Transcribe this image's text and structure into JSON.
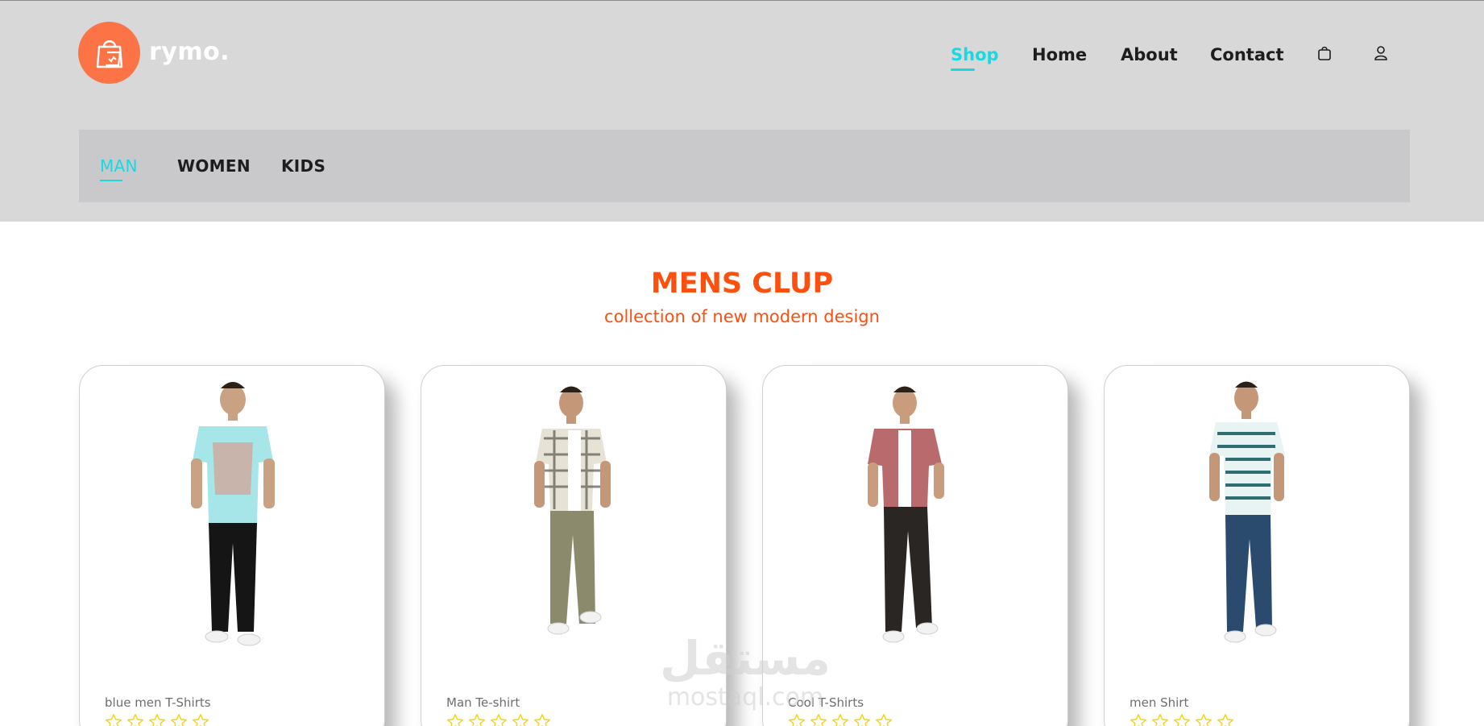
{
  "brand": {
    "name": "rymo.",
    "accent_color": "#fc7446",
    "logo_icon": "shopping-bag-icon"
  },
  "nav": {
    "links": [
      {
        "label": "Shop",
        "active": true
      },
      {
        "label": "Home",
        "active": false
      },
      {
        "label": "About",
        "active": false
      },
      {
        "label": "Contact",
        "active": false
      }
    ],
    "icons": [
      "cart-icon",
      "user-icon"
    ],
    "active_color": "#19d8e0"
  },
  "categories": {
    "items": [
      {
        "label": "MAN",
        "active": true
      },
      {
        "label": "WOMEN",
        "active": false
      },
      {
        "label": "KIDS",
        "active": false
      }
    ]
  },
  "section": {
    "title": "MENS CLUP",
    "subtitle": "collection of new modern design",
    "color": "#fd4f0d"
  },
  "products": [
    {
      "name": "blue men T-Shirts",
      "rating_empty_stars": 5
    },
    {
      "name": "Man Te-shirt",
      "rating_empty_stars": 5
    },
    {
      "name": "Cool T-Shirts",
      "rating_empty_stars": 5
    },
    {
      "name": "men Shirt",
      "rating_empty_stars": 5
    }
  ],
  "watermark": {
    "arabic": "مستقل",
    "latin": "mostaql.com"
  }
}
